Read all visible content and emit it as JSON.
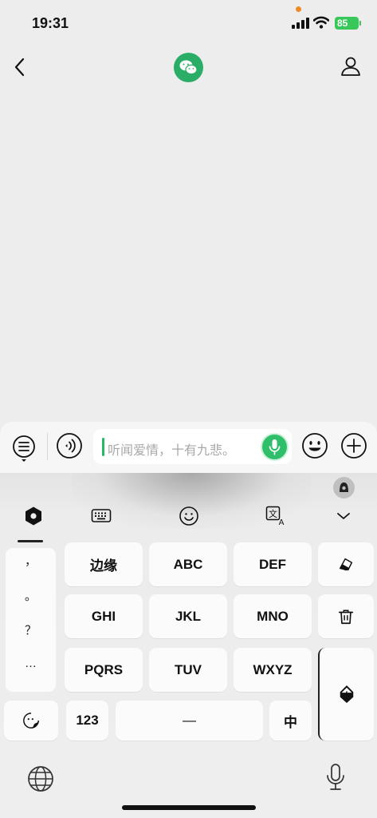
{
  "status": {
    "time": "19:31",
    "battery": "85"
  },
  "input": {
    "placeholder": "听闻爱情，十有九悲。"
  },
  "keyboard": {
    "punctuation": [
      "，",
      "。",
      "？",
      "…"
    ],
    "rows": [
      [
        "边缘",
        "ABC",
        "DEF"
      ],
      [
        "GHI",
        "JKL",
        "MNO"
      ],
      [
        "PQRS",
        "TUV",
        "WXYZ"
      ]
    ],
    "bottom": {
      "numbers": "123",
      "space": "—",
      "lang": "中"
    }
  },
  "colors": {
    "accent": "#2fbf6a",
    "wechat": "#2aae67",
    "battery": "#39c759"
  },
  "icons": [
    "back-icon",
    "wechat-icon",
    "profile-icon",
    "menu-list-icon",
    "voice-icon",
    "mic-icon",
    "emoji-icon",
    "plus-icon",
    "hexagon-icon",
    "keyboard-icon",
    "smile-icon",
    "translate-icon",
    "chevron-down-icon",
    "eraser-icon",
    "trash-icon",
    "return-icon",
    "sticker-icon",
    "globe-icon",
    "dictation-icon"
  ]
}
